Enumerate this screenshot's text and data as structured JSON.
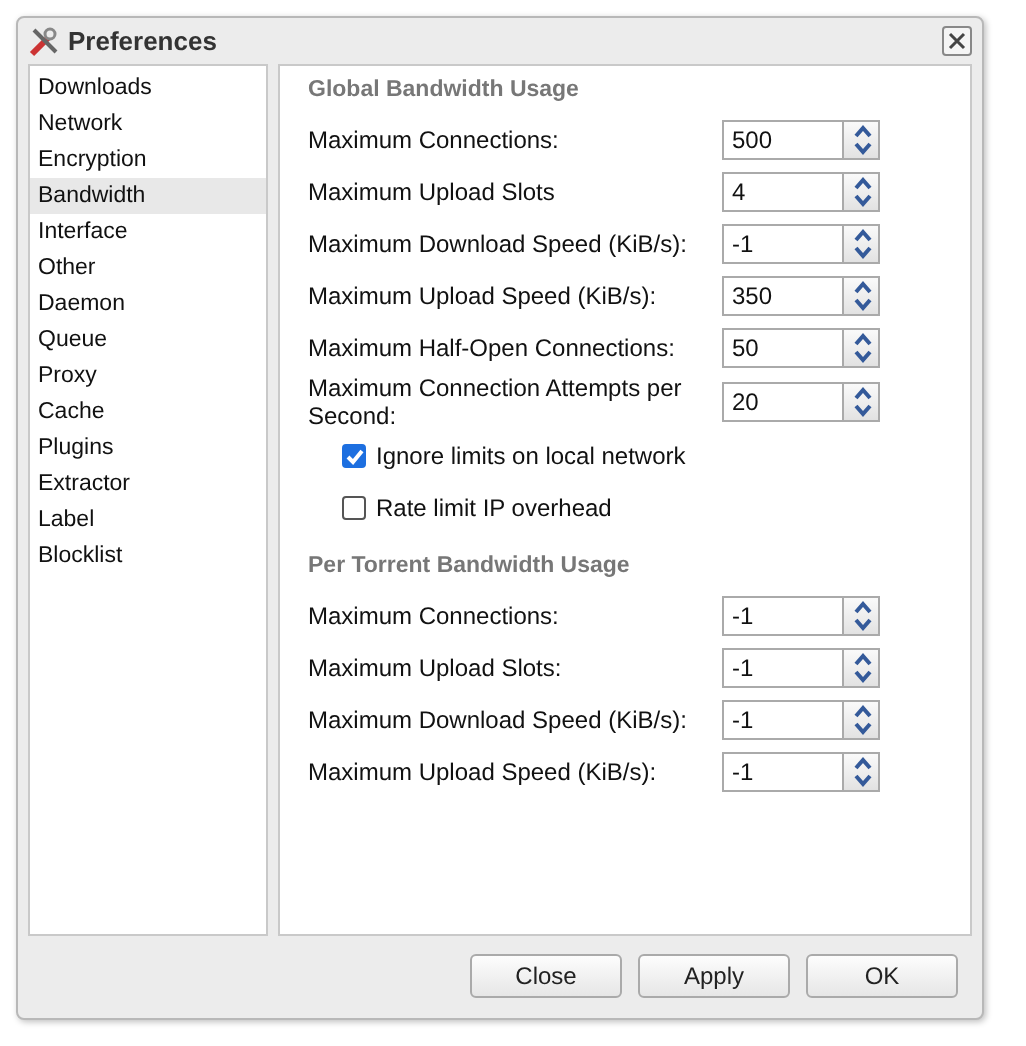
{
  "window": {
    "title": "Preferences"
  },
  "sidebar": {
    "items": [
      {
        "label": "Downloads",
        "selected": false
      },
      {
        "label": "Network",
        "selected": false
      },
      {
        "label": "Encryption",
        "selected": false
      },
      {
        "label": "Bandwidth",
        "selected": true
      },
      {
        "label": "Interface",
        "selected": false
      },
      {
        "label": "Other",
        "selected": false
      },
      {
        "label": "Daemon",
        "selected": false
      },
      {
        "label": "Queue",
        "selected": false
      },
      {
        "label": "Proxy",
        "selected": false
      },
      {
        "label": "Cache",
        "selected": false
      },
      {
        "label": "Plugins",
        "selected": false
      },
      {
        "label": "Extractor",
        "selected": false
      },
      {
        "label": "Label",
        "selected": false
      },
      {
        "label": "Blocklist",
        "selected": false
      }
    ]
  },
  "sections": [
    {
      "title": "Global Bandwidth Usage",
      "items": [
        {
          "kind": "spinner",
          "label": "Maximum Connections:",
          "value": "500"
        },
        {
          "kind": "spinner",
          "label": "Maximum Upload Slots",
          "value": "4"
        },
        {
          "kind": "spinner",
          "label": "Maximum Download Speed (KiB/s):",
          "value": "-1"
        },
        {
          "kind": "spinner",
          "label": "Maximum Upload Speed (KiB/s):",
          "value": "350"
        },
        {
          "kind": "spinner",
          "label": "Maximum Half-Open Connections:",
          "value": "50"
        },
        {
          "kind": "spinner",
          "label": "Maximum Connection Attempts per Second:",
          "value": "20"
        },
        {
          "kind": "checkbox",
          "label": "Ignore limits on local network",
          "checked": true
        },
        {
          "kind": "checkbox",
          "label": "Rate limit IP overhead",
          "checked": false
        }
      ]
    },
    {
      "title": "Per Torrent Bandwidth Usage",
      "items": [
        {
          "kind": "spinner",
          "label": "Maximum Connections:",
          "value": "-1"
        },
        {
          "kind": "spinner",
          "label": "Maximum Upload Slots:",
          "value": "-1"
        },
        {
          "kind": "spinner",
          "label": "Maximum Download Speed (KiB/s):",
          "value": "-1"
        },
        {
          "kind": "spinner",
          "label": "Maximum Upload Speed (KiB/s):",
          "value": "-1"
        }
      ]
    }
  ],
  "buttons": [
    "Close",
    "Apply",
    "OK"
  ]
}
